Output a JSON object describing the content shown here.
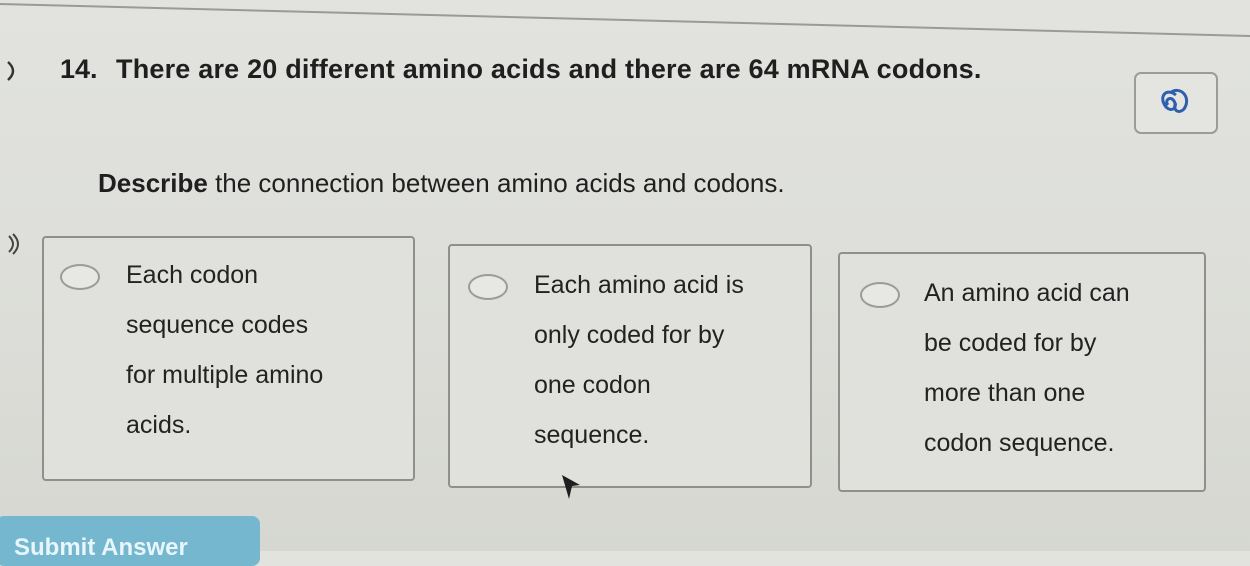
{
  "question": {
    "number": "14.",
    "text": "There are 20 different amino acids and there are 64 mRNA codons.",
    "prompt_bold": "Describe",
    "prompt_rest": " the connection between amino acids and codons."
  },
  "choices": [
    {
      "text": "Each codon\nsequence codes\nfor multiple amino\nacids."
    },
    {
      "text": "Each amino acid is\nonly coded for by\none codon\nsequence."
    },
    {
      "text": "An amino acid can\nbe coded for by\nmore than one\ncodon sequence."
    }
  ],
  "submit": {
    "label": "Submit Answer"
  },
  "icons": {
    "hint": "hint-icon",
    "audio": "speaker-icon"
  }
}
